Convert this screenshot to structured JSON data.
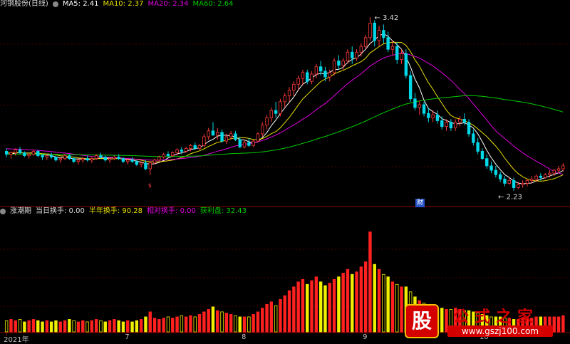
{
  "legend_top": {
    "title": "河钢股份(日线)",
    "ma5": "MA5: 2.41",
    "ma10": "MA10: 2.37",
    "ma20": "MA20: 2.34",
    "ma60": "MA60: 2.64"
  },
  "legend_bottom": {
    "title": "涨潮期",
    "daily": "当日换手: 0.00",
    "half": "半年换手: 90.28",
    "relative": "相对换手: 0.00",
    "profit": "获利盘: 32.43"
  },
  "colors": {
    "up": "#ff3a3a",
    "down": "#00d8e8",
    "ma5": "#ffffff",
    "ma10": "#e8e000",
    "ma20": "#e000e0",
    "ma60": "#00cc00",
    "volume_up": "#ff2020",
    "volume_down": "#f0f000",
    "grid": "#8b0000"
  },
  "chart_data": {
    "type": "candlestick",
    "annotations": {
      "high": "3.42",
      "low": "2.23",
      "marker": "财"
    },
    "x_ticks": [
      {
        "label": "2021年",
        "index": 0
      },
      {
        "label": "7",
        "index": 27
      },
      {
        "label": "8",
        "index": 53
      },
      {
        "label": "9",
        "index": 80
      },
      {
        "label": "10",
        "index": 106
      }
    ],
    "ohlc": [
      [
        2.5,
        2.52,
        2.46,
        2.48
      ],
      [
        2.48,
        2.5,
        2.45,
        2.49
      ],
      [
        2.49,
        2.52,
        2.47,
        2.51
      ],
      [
        2.51,
        2.53,
        2.48,
        2.49
      ],
      [
        2.49,
        2.5,
        2.46,
        2.47
      ],
      [
        2.47,
        2.49,
        2.45,
        2.48
      ],
      [
        2.48,
        2.51,
        2.47,
        2.5
      ],
      [
        2.5,
        2.51,
        2.46,
        2.47
      ],
      [
        2.47,
        2.48,
        2.44,
        2.46
      ],
      [
        2.46,
        2.48,
        2.44,
        2.47
      ],
      [
        2.47,
        2.49,
        2.45,
        2.46
      ],
      [
        2.46,
        2.47,
        2.43,
        2.44
      ],
      [
        2.44,
        2.46,
        2.42,
        2.45
      ],
      [
        2.45,
        2.48,
        2.44,
        2.47
      ],
      [
        2.47,
        2.48,
        2.44,
        2.45
      ],
      [
        2.45,
        2.46,
        2.42,
        2.43
      ],
      [
        2.43,
        2.45,
        2.41,
        2.44
      ],
      [
        2.44,
        2.46,
        2.42,
        2.45
      ],
      [
        2.45,
        2.47,
        2.43,
        2.44
      ],
      [
        2.44,
        2.46,
        2.42,
        2.45
      ],
      [
        2.45,
        2.48,
        2.44,
        2.47
      ],
      [
        2.47,
        2.49,
        2.45,
        2.46
      ],
      [
        2.46,
        2.47,
        2.43,
        2.44
      ],
      [
        2.44,
        2.46,
        2.42,
        2.45
      ],
      [
        2.45,
        2.47,
        2.44,
        2.46
      ],
      [
        2.46,
        2.48,
        2.44,
        2.45
      ],
      [
        2.45,
        2.46,
        2.42,
        2.43
      ],
      [
        2.43,
        2.45,
        2.41,
        2.44
      ],
      [
        2.44,
        2.46,
        2.42,
        2.43
      ],
      [
        2.43,
        2.44,
        2.4,
        2.41
      ],
      [
        2.41,
        2.43,
        2.39,
        2.42
      ],
      [
        2.42,
        2.44,
        2.37,
        2.38
      ],
      [
        2.38,
        2.43,
        2.34,
        2.42
      ],
      [
        2.42,
        2.45,
        2.41,
        2.44
      ],
      [
        2.44,
        2.47,
        2.43,
        2.46
      ],
      [
        2.46,
        2.49,
        2.45,
        2.48
      ],
      [
        2.48,
        2.5,
        2.46,
        2.47
      ],
      [
        2.47,
        2.5,
        2.46,
        2.49
      ],
      [
        2.49,
        2.52,
        2.47,
        2.51
      ],
      [
        2.51,
        2.53,
        2.48,
        2.5
      ],
      [
        2.5,
        2.53,
        2.49,
        2.52
      ],
      [
        2.52,
        2.55,
        2.5,
        2.54
      ],
      [
        2.54,
        2.56,
        2.51,
        2.52
      ],
      [
        2.52,
        2.55,
        2.51,
        2.54
      ],
      [
        2.54,
        2.62,
        2.53,
        2.6
      ],
      [
        2.6,
        2.66,
        2.58,
        2.64
      ],
      [
        2.64,
        2.7,
        2.62,
        2.61
      ],
      [
        2.61,
        2.66,
        2.58,
        2.63
      ],
      [
        2.63,
        2.65,
        2.56,
        2.57
      ],
      [
        2.57,
        2.62,
        2.55,
        2.6
      ],
      [
        2.6,
        2.64,
        2.58,
        2.62
      ],
      [
        2.62,
        2.64,
        2.57,
        2.58
      ],
      [
        2.58,
        2.6,
        2.52,
        2.53
      ],
      [
        2.53,
        2.58,
        2.52,
        2.56
      ],
      [
        2.56,
        2.59,
        2.53,
        2.54
      ],
      [
        2.54,
        2.58,
        2.53,
        2.57
      ],
      [
        2.57,
        2.63,
        2.56,
        2.62
      ],
      [
        2.62,
        2.7,
        2.6,
        2.68
      ],
      [
        2.68,
        2.75,
        2.65,
        2.73
      ],
      [
        2.73,
        2.8,
        2.7,
        2.78
      ],
      [
        2.78,
        2.84,
        2.73,
        2.76
      ],
      [
        2.76,
        2.86,
        2.74,
        2.84
      ],
      [
        2.84,
        2.9,
        2.8,
        2.88
      ],
      [
        2.88,
        2.94,
        2.84,
        2.92
      ],
      [
        2.92,
        2.98,
        2.88,
        2.96
      ],
      [
        2.96,
        3.02,
        2.92,
        3.0
      ],
      [
        3.0,
        3.06,
        2.95,
        3.04
      ],
      [
        3.04,
        3.06,
        2.96,
        2.98
      ],
      [
        2.98,
        3.05,
        2.96,
        3.03
      ],
      [
        3.03,
        3.1,
        3.0,
        3.08
      ],
      [
        3.08,
        3.12,
        3.02,
        3.05
      ],
      [
        3.05,
        3.08,
        2.98,
        3.01
      ],
      [
        3.01,
        3.06,
        2.98,
        3.04
      ],
      [
        3.04,
        3.14,
        3.02,
        3.12
      ],
      [
        3.12,
        3.16,
        3.06,
        3.09
      ],
      [
        3.09,
        3.14,
        3.06,
        3.12
      ],
      [
        3.12,
        3.2,
        3.1,
        3.18
      ],
      [
        3.18,
        3.22,
        3.1,
        3.14
      ],
      [
        3.14,
        3.2,
        3.12,
        3.18
      ],
      [
        3.18,
        3.24,
        3.15,
        3.22
      ],
      [
        3.22,
        3.3,
        3.2,
        3.28
      ],
      [
        3.28,
        3.42,
        3.26,
        3.38
      ],
      [
        3.38,
        3.4,
        3.22,
        3.26
      ],
      [
        3.26,
        3.36,
        3.22,
        3.33
      ],
      [
        3.33,
        3.37,
        3.24,
        3.28
      ],
      [
        3.28,
        3.32,
        3.18,
        3.2
      ],
      [
        3.2,
        3.26,
        3.16,
        3.22
      ],
      [
        3.22,
        3.25,
        3.1,
        3.13
      ],
      [
        3.13,
        3.2,
        3.1,
        3.17
      ],
      [
        3.17,
        3.2,
        3.0,
        3.02
      ],
      [
        3.02,
        3.05,
        2.84,
        2.86
      ],
      [
        2.86,
        2.9,
        2.78,
        2.8
      ],
      [
        2.8,
        2.85,
        2.75,
        2.82
      ],
      [
        2.82,
        2.84,
        2.74,
        2.76
      ],
      [
        2.76,
        2.8,
        2.7,
        2.73
      ],
      [
        2.73,
        2.78,
        2.7,
        2.75
      ],
      [
        2.75,
        2.78,
        2.69,
        2.71
      ],
      [
        2.71,
        2.74,
        2.65,
        2.67
      ],
      [
        2.67,
        2.72,
        2.64,
        2.7
      ],
      [
        2.7,
        2.72,
        2.64,
        2.66
      ],
      [
        2.66,
        2.72,
        2.64,
        2.7
      ],
      [
        2.7,
        2.74,
        2.67,
        2.72
      ],
      [
        2.72,
        2.76,
        2.68,
        2.7
      ],
      [
        2.7,
        2.72,
        2.6,
        2.62
      ],
      [
        2.62,
        2.65,
        2.54,
        2.56
      ],
      [
        2.56,
        2.59,
        2.48,
        2.5
      ],
      [
        2.5,
        2.52,
        2.44,
        2.45
      ],
      [
        2.45,
        2.48,
        2.38,
        2.4
      ],
      [
        2.4,
        2.43,
        2.35,
        2.37
      ],
      [
        2.37,
        2.4,
        2.32,
        2.34
      ],
      [
        2.34,
        2.36,
        2.29,
        2.31
      ],
      [
        2.31,
        2.33,
        2.26,
        2.28
      ],
      [
        2.28,
        2.32,
        2.27,
        2.3
      ],
      [
        2.3,
        2.32,
        2.23,
        2.25
      ],
      [
        2.25,
        2.29,
        2.24,
        2.27
      ],
      [
        2.27,
        2.3,
        2.25,
        2.28
      ],
      [
        2.28,
        2.31,
        2.26,
        2.3
      ],
      [
        2.3,
        2.33,
        2.28,
        2.31
      ],
      [
        2.31,
        2.34,
        2.29,
        2.33
      ],
      [
        2.33,
        2.35,
        2.3,
        2.32
      ],
      [
        2.32,
        2.35,
        2.31,
        2.34
      ],
      [
        2.34,
        2.37,
        2.32,
        2.35
      ],
      [
        2.35,
        2.38,
        2.33,
        2.37
      ],
      [
        2.37,
        2.4,
        2.35,
        2.38
      ],
      [
        2.38,
        2.42,
        2.36,
        2.4
      ]
    ],
    "volume": [
      9,
      10,
      9,
      10,
      8,
      9,
      10,
      9,
      8,
      9,
      8,
      9,
      8,
      9,
      10,
      9,
      8,
      9,
      8,
      9,
      10,
      9,
      8,
      9,
      10,
      9,
      8,
      9,
      8,
      9,
      10,
      12,
      16,
      11,
      10,
      11,
      12,
      11,
      12,
      13,
      12,
      13,
      12,
      14,
      16,
      18,
      20,
      17,
      16,
      15,
      14,
      13,
      12,
      12,
      12,
      14,
      16,
      19,
      22,
      24,
      21,
      26,
      29,
      33,
      36,
      40,
      42,
      38,
      41,
      44,
      40,
      37,
      39,
      42,
      44,
      47,
      50,
      46,
      48,
      52,
      56,
      80,
      54,
      50,
      46,
      44,
      40,
      38,
      36,
      36,
      32,
      28,
      25,
      23,
      21,
      20,
      19,
      19,
      18,
      18,
      19,
      18,
      17,
      17,
      16,
      15,
      14,
      13,
      12,
      12,
      12,
      11,
      11,
      10,
      10,
      11,
      11,
      11,
      12,
      12,
      12,
      12,
      12,
      12,
      13
    ]
  }
}
